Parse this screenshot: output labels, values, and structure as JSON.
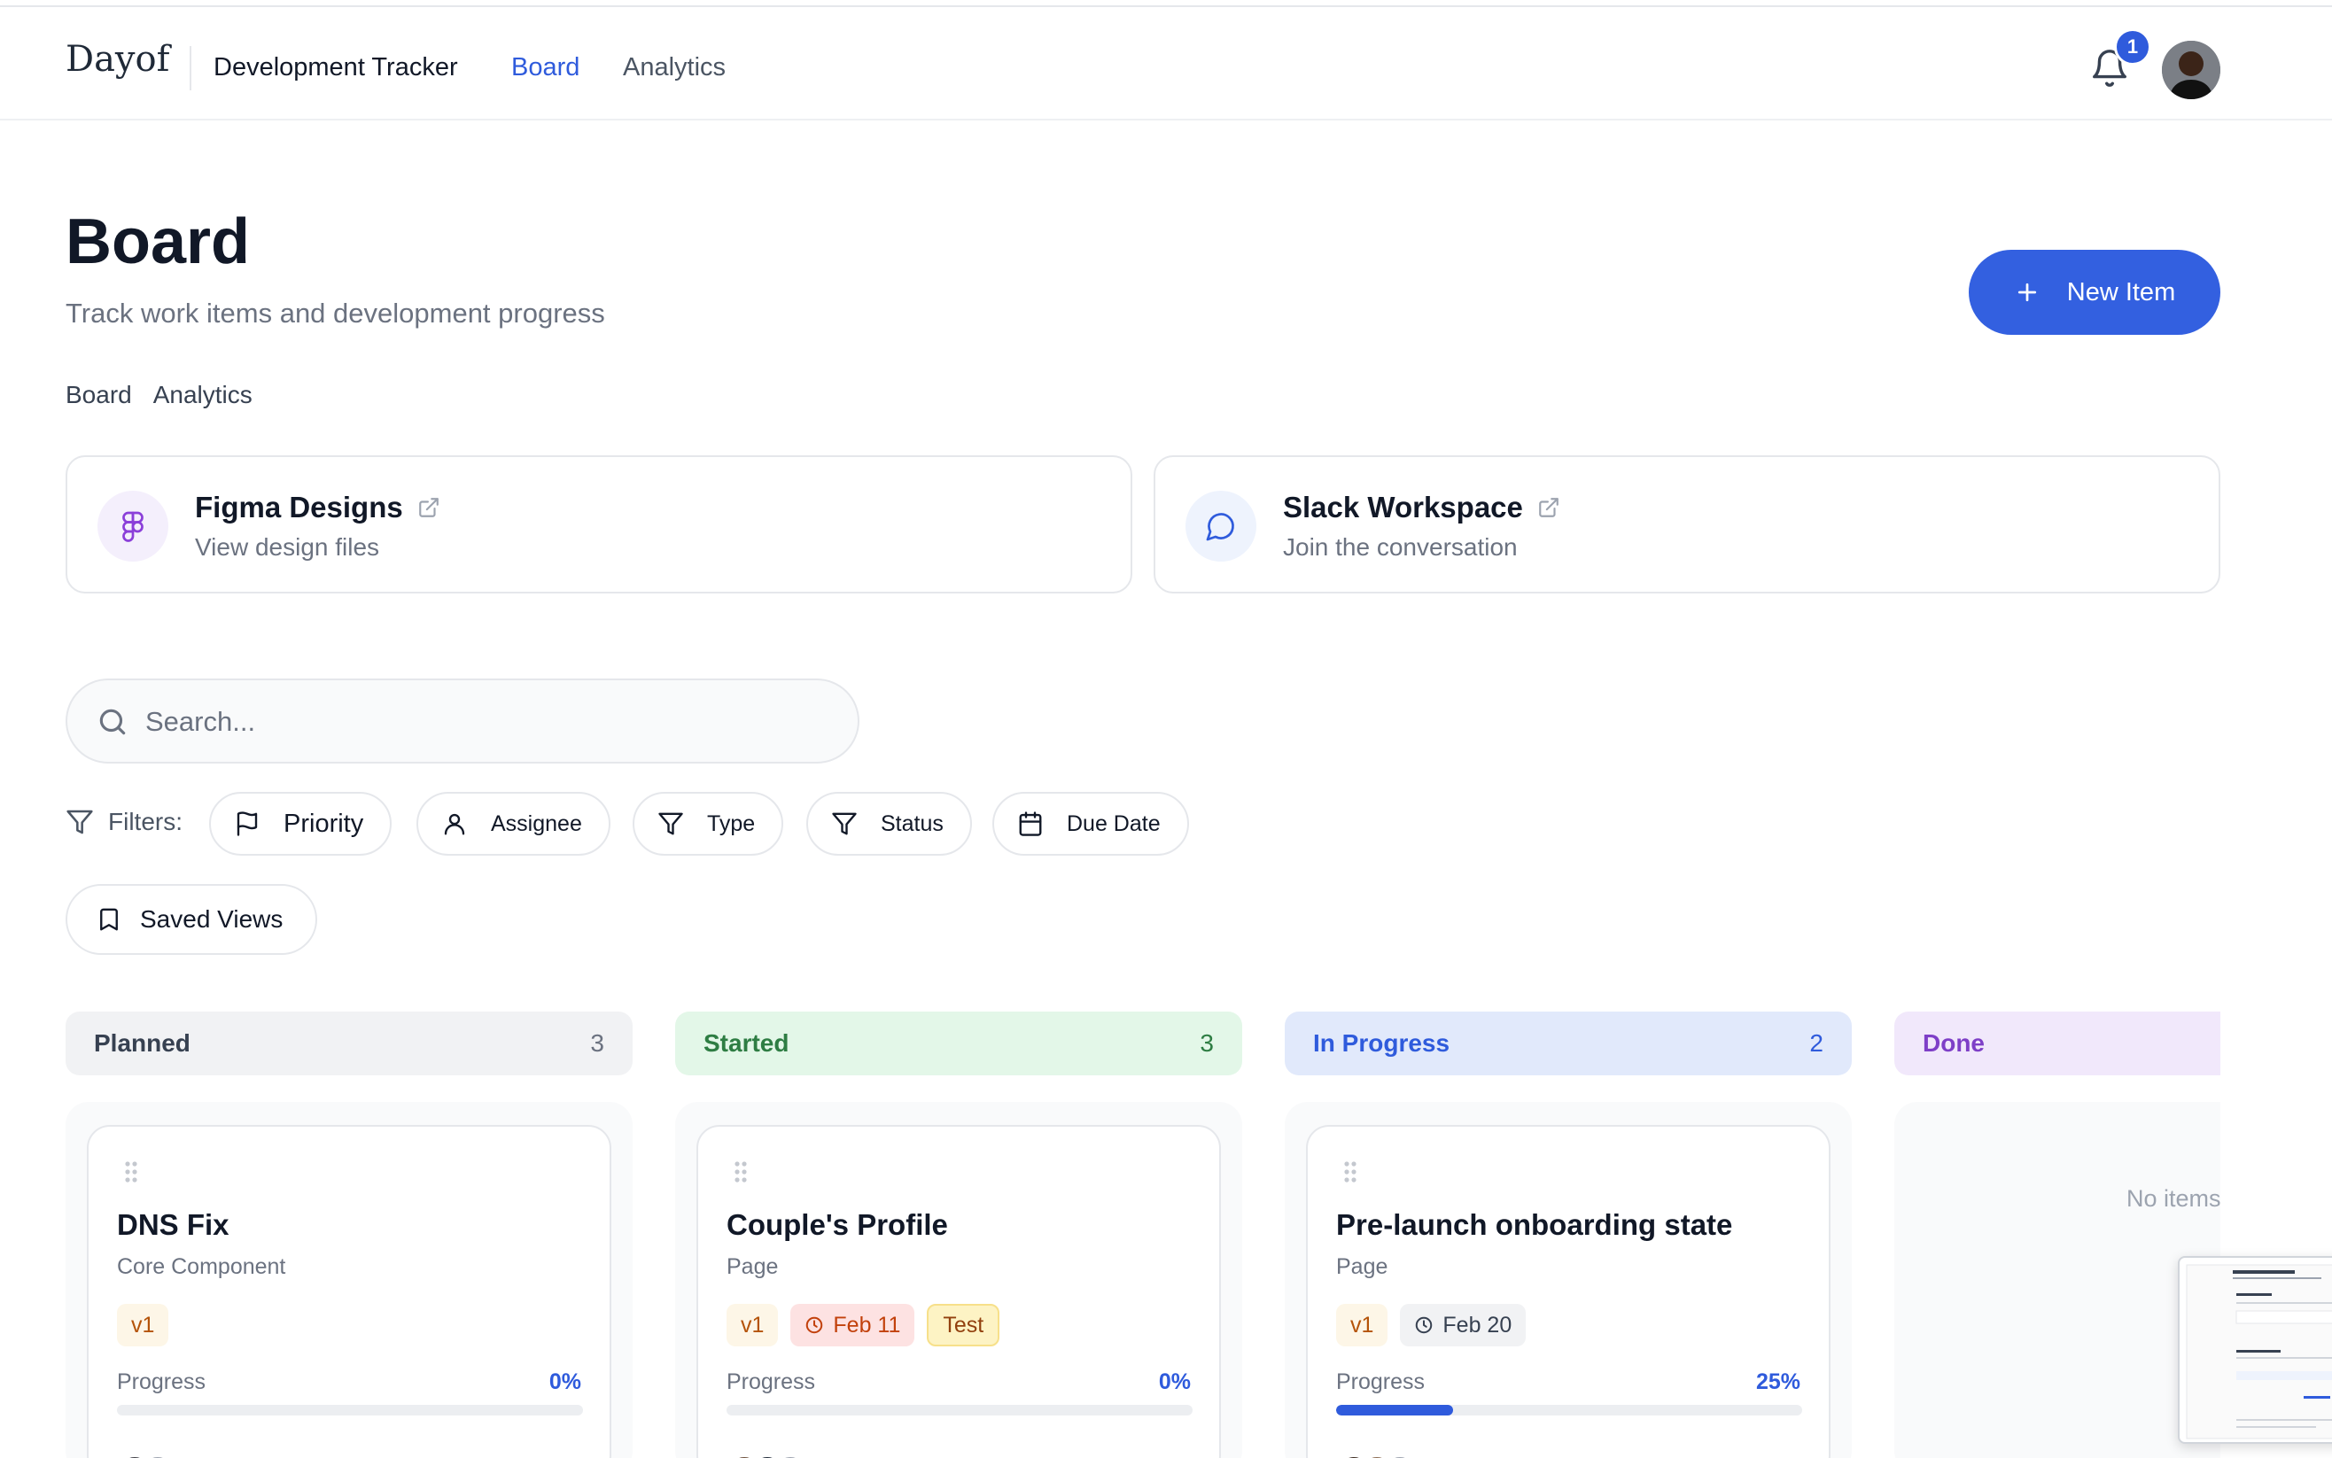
{
  "header": {
    "logo": "Day",
    "logo_suffix": "f",
    "app_title": "Development Tracker",
    "nav": {
      "board": "Board",
      "analytics": "Analytics"
    },
    "notification_count": "1"
  },
  "page": {
    "title": "Board",
    "subtitle": "Track work items and development progress",
    "new_item_label": "New Item",
    "tabs": {
      "board": "Board",
      "analytics": "Analytics"
    }
  },
  "links": {
    "figma": {
      "title": "Figma Designs",
      "subtitle": "View design files"
    },
    "slack": {
      "title": "Slack Workspace",
      "subtitle": "Join the conversation"
    }
  },
  "search": {
    "placeholder": "Search..."
  },
  "filters": {
    "label": "Filters:",
    "priority": "Priority",
    "assignee": "Assignee",
    "type": "Type",
    "status": "Status",
    "due_date": "Due Date",
    "saved_views": "Saved Views"
  },
  "columns": {
    "planned": {
      "name": "Planned",
      "count": "3"
    },
    "started": {
      "name": "Started",
      "count": "3"
    },
    "in_progress": {
      "name": "In Progress",
      "count": "2"
    },
    "done": {
      "name": "Done",
      "empty_text": "No items"
    }
  },
  "cards": {
    "dns_fix": {
      "title": "DNS Fix",
      "type": "Core Component",
      "version": "v1",
      "progress_label": "Progress",
      "progress": "0%",
      "progress_value": 0
    },
    "couples_profile": {
      "title": "Couple's Profile",
      "type": "Page",
      "version": "v1",
      "due": "Feb 11",
      "tag": "Test",
      "progress_label": "Progress",
      "progress": "0%",
      "progress_value": 0
    },
    "prelaunch": {
      "title": "Pre-launch onboarding state",
      "type": "Page",
      "version": "v1",
      "due": "Feb 20",
      "progress_label": "Progress",
      "progress": "25%",
      "progress_value": 25
    }
  },
  "colors": {
    "accent": "#3360e0",
    "planned_bg": "#f1f2f4",
    "started_bg": "#e3f7e8",
    "in_progress_bg": "#e1e9fb",
    "done_bg": "#f1e8fb"
  }
}
